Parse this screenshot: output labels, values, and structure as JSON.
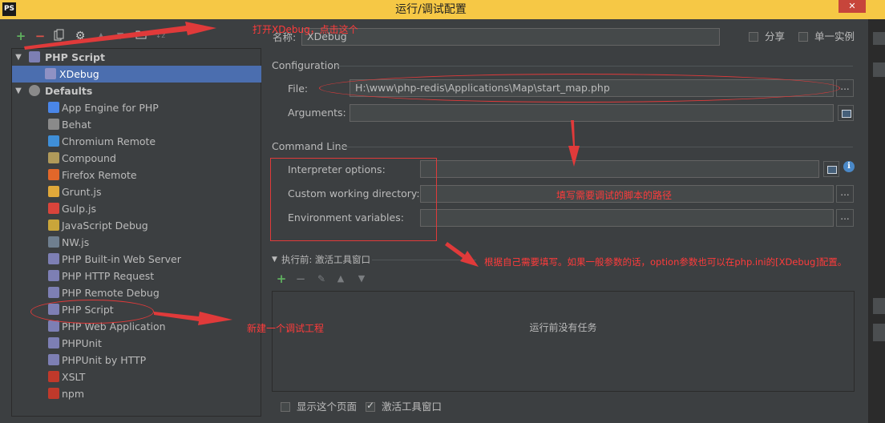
{
  "window": {
    "title": "运行/调试配置",
    "close_label": "✕",
    "logo_text": "PS"
  },
  "toolbar": {
    "icons": [
      "add-icon",
      "remove-icon",
      "copy-icon",
      "settings-icon",
      "move-up-icon",
      "move-down-icon",
      "folder-icon",
      "sort-icon"
    ]
  },
  "tree": {
    "php_script_group": "PHP Script",
    "xdebug_item": "XDebug",
    "defaults_group": "Defaults",
    "items": [
      {
        "label": "App Engine for PHP",
        "icon": "app-engine-icon",
        "color": "#4a86e8"
      },
      {
        "label": "Behat",
        "icon": "behat-icon",
        "color": "#8a8a8a"
      },
      {
        "label": "Chromium Remote",
        "icon": "chromium-icon",
        "color": "#3f8fd8"
      },
      {
        "label": "Compound",
        "icon": "compound-icon",
        "color": "#b09a5a"
      },
      {
        "label": "Firefox Remote",
        "icon": "firefox-icon",
        "color": "#e2672a"
      },
      {
        "label": "Grunt.js",
        "icon": "grunt-icon",
        "color": "#e0a83a"
      },
      {
        "label": "Gulp.js",
        "icon": "gulp-icon",
        "color": "#d9443b"
      },
      {
        "label": "JavaScript Debug",
        "icon": "javascript-debug-icon",
        "color": "#c9a53a"
      },
      {
        "label": "NW.js",
        "icon": "nwjs-icon",
        "color": "#6f7f8f"
      },
      {
        "label": "PHP Built-in Web Server",
        "icon": "php-builtin-server-icon",
        "color": "#7d7fb4"
      },
      {
        "label": "PHP HTTP Request",
        "icon": "php-http-request-icon",
        "color": "#7d7fb4"
      },
      {
        "label": "PHP Remote Debug",
        "icon": "php-remote-debug-icon",
        "color": "#7d7fb4"
      },
      {
        "label": "PHP Script",
        "icon": "php-script-icon",
        "color": "#7d7fb4"
      },
      {
        "label": "PHP Web Application",
        "icon": "php-web-app-icon",
        "color": "#7d7fb4"
      },
      {
        "label": "PHPUnit",
        "icon": "phpunit-icon",
        "color": "#7d7fb4"
      },
      {
        "label": "PHPUnit by HTTP",
        "icon": "phpunit-http-icon",
        "color": "#7d7fb4"
      },
      {
        "label": "XSLT",
        "icon": "xslt-icon",
        "color": "#c0392b"
      },
      {
        "label": "npm",
        "icon": "npm-icon",
        "color": "#c0392b"
      }
    ]
  },
  "form": {
    "name_label": "名称:",
    "name_value": "XDebug",
    "share_label": "分享",
    "single_instance_label": "单一实例",
    "configuration_label": "Configuration",
    "file_label": "File:",
    "file_value": "H:\\www\\php-redis\\Applications\\Map\\start_map.php",
    "arguments_label": "Arguments:",
    "arguments_value": "",
    "command_line_label": "Command Line",
    "interpreter_options_label": "Interpreter options:",
    "custom_working_dir_label": "Custom working directory:",
    "env_vars_label": "Environment variables:",
    "browse_label": "...",
    "info_label": "i",
    "before_launch_label": "执行前: 激活工具窗口",
    "no_tasks_text": "运行前没有任务",
    "show_page_label": "显示这个页面",
    "activate_tool_window_label": "激活工具窗口",
    "show_page_checked": false,
    "activate_tool_window_checked": true
  },
  "annotations": {
    "open_xdebug": "打开XDebug，点击这个",
    "fill_script_path": "填写需要调试的脚本的路径",
    "fill_as_needed": "根据自己需要填写。如果一般参数的话，option参数也可以在php.ini的[XDebug]配置。",
    "new_debug_project": "新建一个调试工程"
  },
  "colors": {
    "selection": "#4b6eaf",
    "annotation_red": "#e03a3a",
    "title_bar": "#f6c845"
  }
}
